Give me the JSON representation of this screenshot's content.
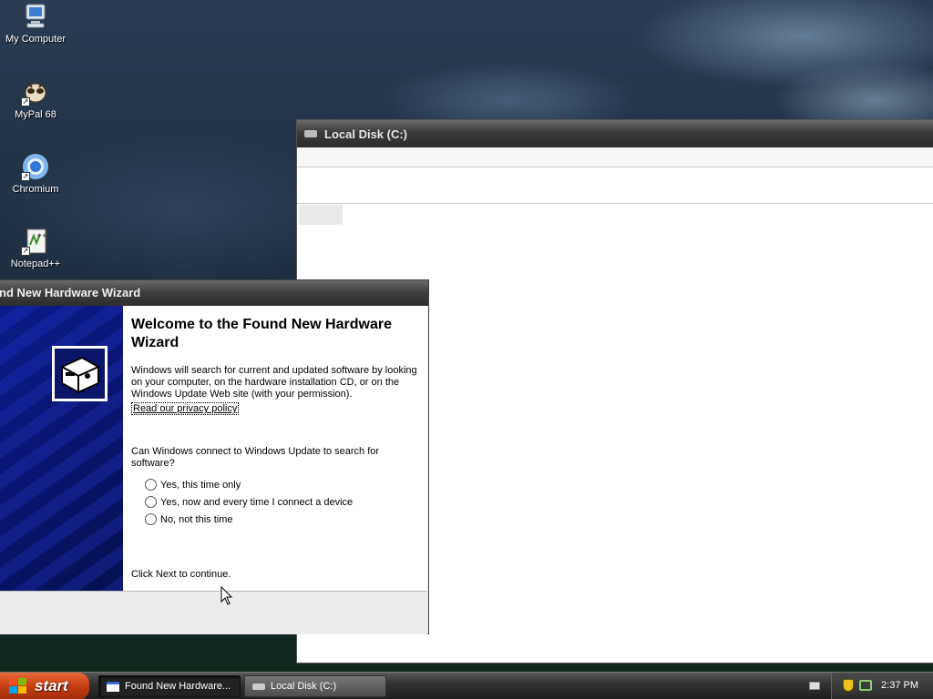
{
  "desktop": {
    "icons": [
      {
        "label": "My Computer",
        "icon": "my-computer-icon"
      },
      {
        "label": "MyPal 68",
        "icon": "mypal-icon"
      },
      {
        "label": "Chromium",
        "icon": "chromium-icon"
      },
      {
        "label": "Notepad++",
        "icon": "notepadpp-icon"
      }
    ]
  },
  "explorer": {
    "title": "Local Disk (C:)"
  },
  "wizard": {
    "title": "nd New Hardware Wizard",
    "heading": "Welcome to the Found New Hardware Wizard",
    "paragraph": "Windows will search for current and updated software by looking on your computer, on the hardware installation CD, or on the Windows Update Web site (with your permission).",
    "privacy_link": "Read our privacy policy",
    "question": "Can Windows connect to Windows Update to search for software?",
    "options": [
      {
        "label": "Yes, this time only",
        "selected": false
      },
      {
        "label": "Yes, now and every time I connect a device",
        "selected": false
      },
      {
        "label": "No, not this time",
        "selected": false
      }
    ],
    "footer_text": "Click Next to continue."
  },
  "taskbar": {
    "start_label": "start",
    "tasks": [
      {
        "label": "Found New Hardware...",
        "active": true
      },
      {
        "label": "Local Disk (C:)",
        "active": false
      }
    ],
    "clock": "2:37 PM"
  },
  "colors": {
    "start_button": "#c43c10",
    "wizard_side": "#0a1470",
    "titlebar": "#3b3b3b"
  }
}
